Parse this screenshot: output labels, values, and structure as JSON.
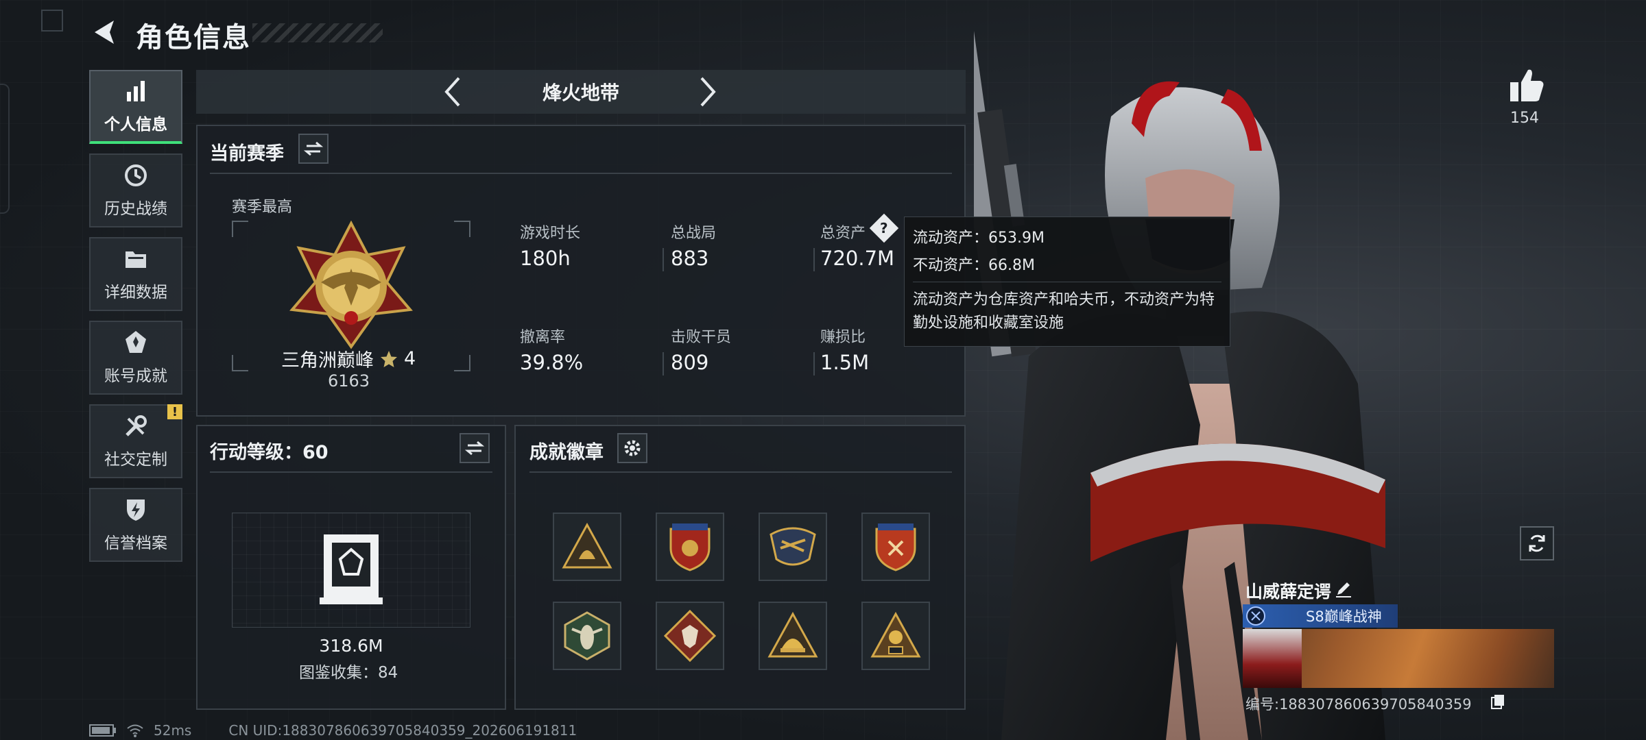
{
  "header": {
    "title": "角色信息"
  },
  "sidebar": {
    "items": [
      {
        "label": "个人信息",
        "icon": "bar-chart-icon",
        "active": true
      },
      {
        "label": "历史战绩",
        "icon": "clock-icon"
      },
      {
        "label": "详细数据",
        "icon": "folder-icon"
      },
      {
        "label": "账号成就",
        "icon": "medal-icon"
      },
      {
        "label": "社交定制",
        "icon": "tools-icon",
        "badge": "!"
      },
      {
        "label": "信誉档案",
        "icon": "shield-bolt-icon"
      }
    ]
  },
  "mode": {
    "title": "烽火地带"
  },
  "season": {
    "title": "当前赛季",
    "best_label": "赛季最高",
    "rank_name": "三角洲巅峰",
    "rank_stars": "4",
    "rank_score": "6163",
    "stats": [
      {
        "label": "游戏时长",
        "value": "180h"
      },
      {
        "label": "总战局",
        "value": "883"
      },
      {
        "label": "总资产",
        "value": "720.7M"
      },
      {
        "label": "撤离率",
        "value": "39.8%"
      },
      {
        "label": "击败干员",
        "value": "809"
      },
      {
        "label": "赚损比",
        "value": "1.5M"
      }
    ]
  },
  "tooltip": {
    "liquid": "流动资产：653.9M",
    "fixed": "不动资产：66.8M",
    "desc": "流动资产为仓库资产和哈夫币，不动资产为特勤处设施和收藏室设施"
  },
  "level": {
    "title": "行动等级：60",
    "value": "318.6M",
    "collection": "图鉴收集：84"
  },
  "achievements": {
    "title": "成就徽章",
    "badges": [
      "triangle-helmet-badge",
      "shield-stars-badge",
      "crest-badge",
      "shield-stars-red-badge",
      "hex-hornet-badge",
      "diamond-wolf-badge",
      "triangle-helmet-2-badge",
      "triangle-s6-badge"
    ]
  },
  "profile": {
    "likes": "154",
    "name": "山威薛定谔",
    "title_badge": "S8巅峰战神",
    "uid_line": "编号:18830786063970584035​9"
  },
  "footer": {
    "ping": "52ms",
    "uid": "CN UID:1883078606397058403​59_202606191811"
  },
  "colors": {
    "accent_green": "#3fe07a",
    "warning_yellow": "#e8c24a",
    "title_blue": "#2c5fb0"
  }
}
